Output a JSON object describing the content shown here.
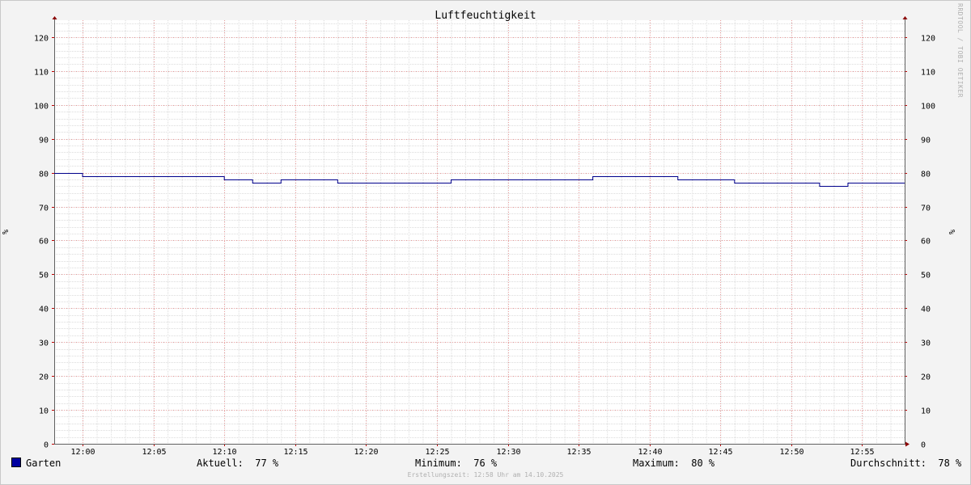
{
  "chart_data": {
    "type": "line",
    "title": "Luftfeuchtigkeit",
    "ylabel": "%",
    "ylim": [
      0,
      125
    ],
    "y_ticks": [
      0,
      10,
      20,
      30,
      40,
      50,
      60,
      70,
      80,
      90,
      100,
      110,
      120
    ],
    "xlim": [
      "11:58",
      "12:58"
    ],
    "x_ticks": [
      "12:00",
      "12:05",
      "12:10",
      "12:15",
      "12:20",
      "12:25",
      "12:30",
      "12:35",
      "12:40",
      "12:45",
      "12:50",
      "12:55"
    ],
    "grid": true,
    "series": [
      {
        "name": "Garten",
        "color": "#00008b",
        "x": [
          "11:58",
          "12:00",
          "12:10",
          "12:12",
          "12:14",
          "12:18",
          "12:26",
          "12:36",
          "12:42",
          "12:46",
          "12:52",
          "12:54",
          "12:58"
        ],
        "values": [
          80,
          79,
          78,
          77,
          78,
          77,
          78,
          79,
          78,
          77,
          76,
          77,
          77
        ]
      }
    ]
  },
  "legend": {
    "series_name": "Garten",
    "swatch_color": "#0000a0",
    "current_label": "Aktuell:",
    "current_value": "77 %",
    "min_label": "Minimum:",
    "min_value": "76 %",
    "max_label": "Maximum:",
    "max_value": "80 %",
    "avg_label": "Durchschnitt:",
    "avg_value": "78 %"
  },
  "footer_text": "Erstellungszeit: 12:58 Uhr am 14.10.2025",
  "side_credit": "RRDTOOL / TOBI OETIKER"
}
